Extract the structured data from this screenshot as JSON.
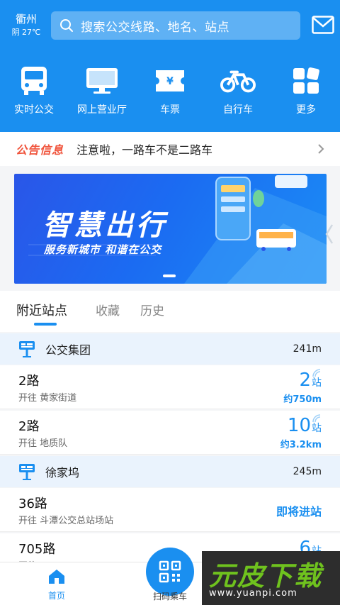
{
  "header": {
    "city": "衢州",
    "weather": "阴 27℃",
    "search_placeholder": "搜索公交线路、地名、站点"
  },
  "shortcuts": [
    {
      "label": "实时公交",
      "icon": "bus-icon"
    },
    {
      "label": "网上营业厅",
      "icon": "monitor-icon"
    },
    {
      "label": "车票",
      "icon": "ticket-icon"
    },
    {
      "label": "自行车",
      "icon": "bicycle-icon"
    },
    {
      "label": "更多",
      "icon": "more-grid-icon"
    }
  ],
  "notice": {
    "tag": "公告信息",
    "text": "注意啦，一路车不是二路车"
  },
  "banner": {
    "title": "智慧出行",
    "subtitle": "服务新城市 和谐在公交"
  },
  "tabs": [
    "附近站点",
    "收藏",
    "历史"
  ],
  "active_tab": "附近站点",
  "stop_groups": [
    {
      "name": "公交集团",
      "distance": "241m",
      "routes": [
        {
          "route": "2路",
          "destination": "开往 黄家街道",
          "stops_num": "2",
          "stops_unit": "站",
          "approx": "约750m"
        },
        {
          "route": "2路",
          "destination": "开往 地质队",
          "stops_num": "10",
          "stops_unit": "站",
          "approx": "约3.2km"
        }
      ]
    },
    {
      "name": "徐家坞",
      "distance": "245m",
      "routes": [
        {
          "route": "36路",
          "destination": "开往 斗潭公交总站场站",
          "status": "即将进站"
        },
        {
          "route": "705路",
          "destination": "开往 ...",
          "stops_num": "6",
          "stops_unit": "站"
        }
      ]
    }
  ],
  "bottom_nav": {
    "home": "首页",
    "scan": "扫码乘车"
  },
  "watermark": {
    "brand": "元皮下载",
    "url": "www.yuanpi.com"
  },
  "colors": {
    "primary": "#1a8ff0",
    "notice_tag": "#f0543c",
    "group_bg": "#eaf3fd"
  }
}
